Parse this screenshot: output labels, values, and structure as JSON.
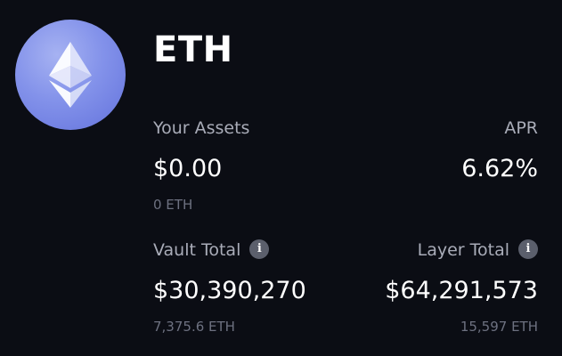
{
  "token": {
    "symbol": "ETH",
    "icon": "ethereum-icon"
  },
  "assets": {
    "label": "Your Assets",
    "value": "$0.00",
    "sub": "0 ETH"
  },
  "apr": {
    "label": "APR",
    "value": "6.62%"
  },
  "vault_total": {
    "label": "Vault Total",
    "value": "$30,390,270",
    "sub": "7,375.6 ETH",
    "info_icon": "i"
  },
  "layer_total": {
    "label": "Layer Total",
    "value": "$64,291,573",
    "sub": "15,597 ETH",
    "info_icon": "i"
  },
  "colors": {
    "background": "#0b0d14",
    "logo_gradient": "#8392ea",
    "label": "#a9acb8",
    "subtext": "#6d7180",
    "info_icon_bg": "#5b5f6c"
  }
}
